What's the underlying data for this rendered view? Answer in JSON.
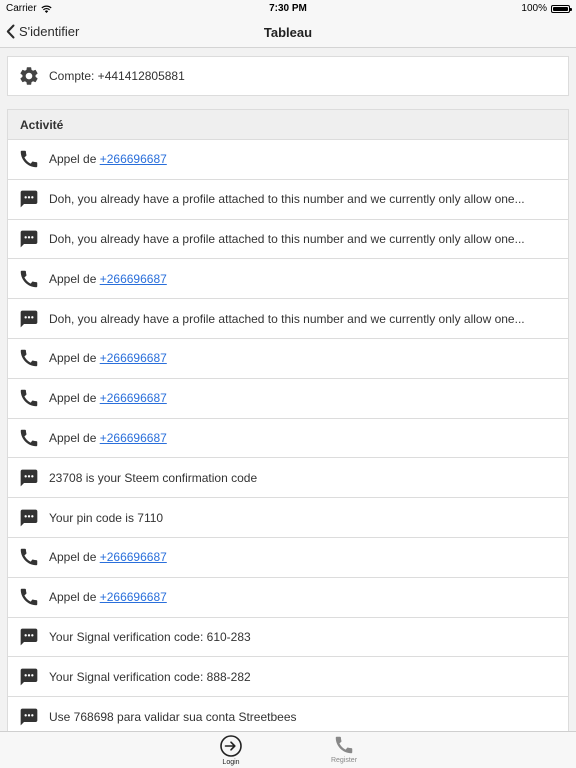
{
  "status_bar": {
    "carrier": "Carrier",
    "time": "7:30 PM",
    "battery": "100%"
  },
  "nav": {
    "back_label": "S'identifier",
    "title": "Tableau"
  },
  "account": {
    "label": "Compte: +441412805881",
    "icon": "gear-icon"
  },
  "activity": {
    "header": "Activité",
    "rows": [
      {
        "type": "call",
        "icon": "phone-icon",
        "prefix": "Appel de ",
        "link": "+266696687"
      },
      {
        "type": "message",
        "icon": "message-icon",
        "text": "Doh, you already have a profile attached to this number and we currently only allow one..."
      },
      {
        "type": "message",
        "icon": "message-icon",
        "text": "Doh, you already have a profile attached to this number and we currently only allow one..."
      },
      {
        "type": "call",
        "icon": "phone-icon",
        "prefix": "Appel de ",
        "link": "+266696687"
      },
      {
        "type": "message",
        "icon": "message-icon",
        "text": "Doh, you already have a profile attached to this number and we currently only allow one..."
      },
      {
        "type": "call",
        "icon": "phone-icon",
        "prefix": "Appel de ",
        "link": "+266696687"
      },
      {
        "type": "call",
        "icon": "phone-icon",
        "prefix": "Appel de ",
        "link": "+266696687"
      },
      {
        "type": "call",
        "icon": "phone-icon",
        "prefix": "Appel de ",
        "link": "+266696687"
      },
      {
        "type": "message",
        "icon": "message-icon",
        "text": "23708 is your Steem confirmation code"
      },
      {
        "type": "message",
        "icon": "message-icon",
        "text": "Your pin code is 7110"
      },
      {
        "type": "call",
        "icon": "phone-icon",
        "prefix": "Appel de ",
        "link": "+266696687"
      },
      {
        "type": "call",
        "icon": "phone-icon",
        "prefix": "Appel de ",
        "link": "+266696687"
      },
      {
        "type": "message",
        "icon": "message-icon",
        "text": "Your Signal verification code: 610-283"
      },
      {
        "type": "message",
        "icon": "message-icon",
        "text": "Your Signal verification code: 888-282"
      },
      {
        "type": "message",
        "icon": "message-icon",
        "text": "Use 768698 para validar sua conta Streetbees"
      }
    ]
  },
  "tabs": [
    {
      "label": "Login",
      "icon": "login-icon",
      "active": true
    },
    {
      "label": "Register",
      "icon": "phone-icon",
      "active": false
    }
  ],
  "colors": {
    "link": "#2a6fdb",
    "background": "#f2f2f2",
    "active_tab": "#222222",
    "inactive_tab": "#888888"
  }
}
